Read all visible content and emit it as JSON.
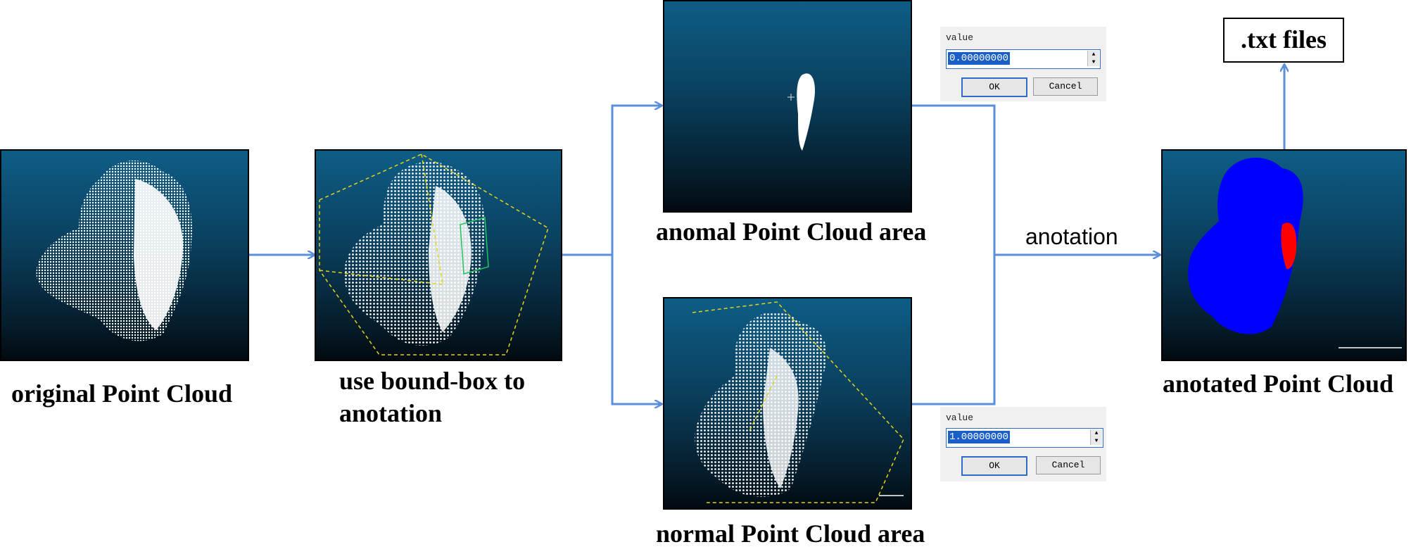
{
  "captions": {
    "original": "original Point Cloud",
    "bound_box_line1": "use bound-box to",
    "bound_box_line2": "anotation",
    "anomal": "anomal Point Cloud area",
    "normal": "normal Point Cloud area",
    "anotated": "anotated Point Cloud"
  },
  "arrow_label": "anotation",
  "output_box": ".txt files",
  "dialog_top": {
    "label": "value",
    "value": "0.00000000",
    "ok": "OK",
    "cancel": "Cancel"
  },
  "dialog_bottom": {
    "label": "value",
    "value": "1.00000000",
    "ok": "OK",
    "cancel": "Cancel"
  },
  "colors": {
    "arrow": "#5b8fd9",
    "panel_top": "#0e5d86",
    "panel_bottom": "#020a10",
    "anomaly": "#ff0000",
    "normal": "#0000ff",
    "bbox": "#e5d414"
  }
}
